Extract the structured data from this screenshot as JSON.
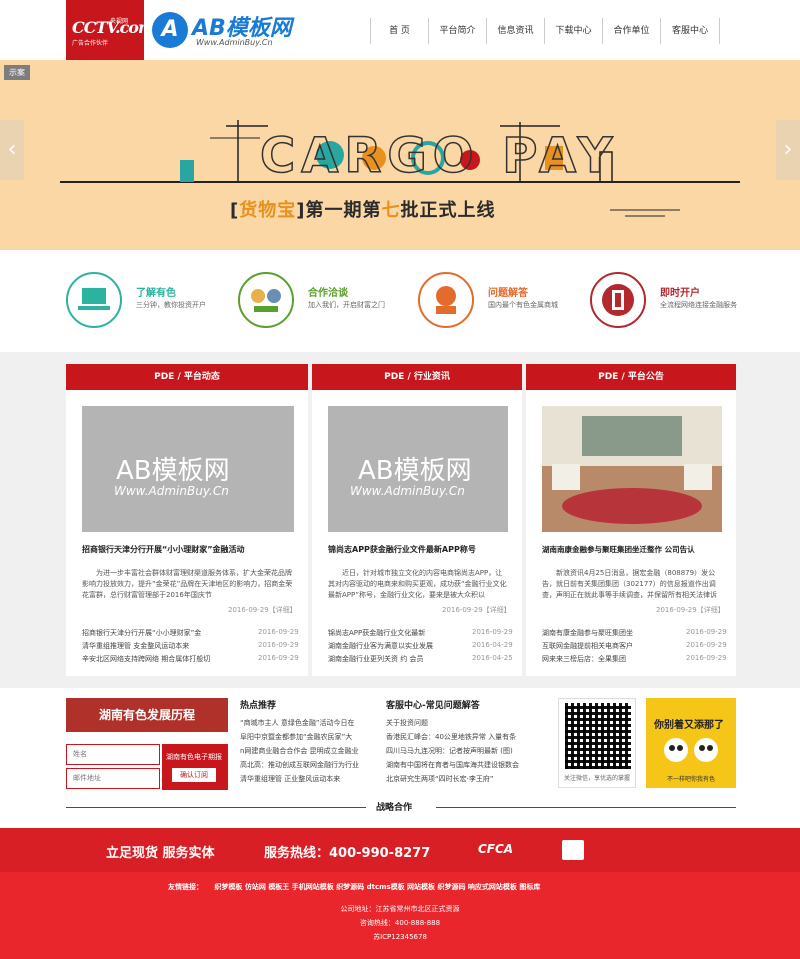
{
  "header": {
    "cctv_main": "CCTV.com",
    "cctv_small": "央视网",
    "cctv_sub": "广告合作伙伴",
    "ab_mark": "A",
    "ab_title": "AB模板网",
    "ab_url": "Www.AdminBuy.Cn",
    "nav": [
      "首 页",
      "平台简介",
      "信息资讯",
      "下载中心",
      "合作单位",
      "客服中心"
    ]
  },
  "banner": {
    "tag": "示案",
    "cargo_text": "CARGO PAY",
    "headline_pre": "[",
    "headline_hl": "货物宝",
    "headline_mid": "]第一期第",
    "headline_hl2": "七",
    "headline_post": "批正式上线",
    "left_arrow": "‹",
    "right_arrow": "›"
  },
  "services": [
    {
      "title": "了解有色",
      "desc": "三分钟，教你投资开户",
      "color": "#2bb3a0",
      "icon": "computer-icon"
    },
    {
      "title": "合作洽谈",
      "desc": "加入我们，开启财富之门",
      "color": "#5aa02c",
      "icon": "handshake-icon"
    },
    {
      "title": "问题解答",
      "desc": "国内最个有色金属商城",
      "color": "#e36b2c",
      "icon": "question-icon"
    },
    {
      "title": "即时开户",
      "desc": "全流程网络连接金融服务",
      "color": "#b3282d",
      "icon": "account-icon"
    }
  ],
  "columns": [
    {
      "head": "PDE / 平台动态",
      "wm1": "AB模板网",
      "wm2": "Www.AdminBuy.Cn",
      "title": "招商银行天津分行开展“小小理财家”金融活动",
      "desc": "为进一步丰富社会群体财富理财渠道服务体系，扩大金荣花品牌影响力投放效力，提升“金荣花”品牌在天津地区的影响力，招商金荣花富群，总行财富管理部于2016年国庆节",
      "date": "2016-09-29【详细】",
      "list": [
        {
          "t": "招商银行天津分行开展“小小理财家”金",
          "d": "2016-09-29"
        },
        {
          "t": "清华重组推理管 支金整风运动本来",
          "d": "2016-09-29"
        },
        {
          "t": "辛安北区网络支持跨网络 期合属体打般切",
          "d": "2016-09-29"
        }
      ]
    },
    {
      "head": "PDE / 行业资讯",
      "wm1": "AB模板网",
      "wm2": "Www.AdminBuy.Cn",
      "title": "锦尚志APP获金融行业文件最新APP称号",
      "desc": "近日，针对城市独立文化的内容电商锦尚志APP，让其对内容驱动的电商来和购买更观，成功获“金融行业文化最新APP”称号，金融行业文化，要来是被大众积以",
      "date": "2016-09-29【详细】",
      "list": [
        {
          "t": "锦尚志APP获金融行业文化最新",
          "d": "2016-09-29"
        },
        {
          "t": "湖南金融行业客为满意以实业发展",
          "d": "2016-04-29"
        },
        {
          "t": "湖南金融行业更列关资 约 会员",
          "d": "2016-04-25"
        }
      ]
    },
    {
      "head": "PDE / 平台公告",
      "title": "湖南南康金融参与聚旺集团坐迁整作 公司告认",
      "desc": "新浪资讯4月25日消息，据宏金融（808879）发公告，就日前有关集团集团（302177）的信息报道作出调查，声明正在就此事等手续调查，并保留所有相关法律诉讼",
      "date": "2016-09-29【详细】",
      "list": [
        {
          "t": "湖南有康金融参与聚旺集团坐",
          "d": "2016-09-29"
        },
        {
          "t": "互联网金融提前相关电商客户",
          "d": "2016-09-29"
        },
        {
          "t": "网来来三榜后店：全果集团",
          "d": "2016-09-29"
        }
      ]
    }
  ],
  "info": {
    "hn_banner": "湖南有色发展历程",
    "name_placeholder": "姓名",
    "email_placeholder": "邮件地址",
    "sub_text": "湖南有色电子期报",
    "sub_button": "确认订阅",
    "hot_title": "热点推荐",
    "hot_items": [
      "“商城市主人 意绿色金融”活动今日在",
      "阜阳中京暨金都参加“金融农民家”大",
      "n网建商业融合合作会 昆明成立金融业",
      "高北高：推动创成互联网金融行为行业",
      "清华重组理管 正业整风运动本来"
    ],
    "faq_title": "客服中心-常见问题解答",
    "faq_items": [
      "关于投资问题",
      "香港民汇峰会：40公里地铁异常 入量有条",
      "四川马马九连况明：记者按声明最新 (图)",
      "湖南有中国将在育者与国库海共建设银数会",
      "北京研究生两项“四时长宏·李王府”"
    ],
    "qr_caption": "关注微信，享优选的掌握",
    "promo_head": "你别着又添那了",
    "promo_caption": "不一样吧你我有色",
    "strategy": "战略合作"
  },
  "footer": {
    "slogan1": "立足现货 服务实体",
    "slogan2": "服务热线：400-990-8277",
    "cfca": "CFCA",
    "links_label": "友情链接：",
    "links": [
      "织梦模板",
      "仿站网",
      "模板王",
      "手机网站模板",
      "织梦源码",
      "dtcms模板",
      "网站模板",
      "织梦源码",
      "响应式网站模板",
      "图标库"
    ],
    "address": "公司地址：江苏省常州市北区正式资源",
    "phone": "咨询热线：400-888-888",
    "icp": "苏ICP12345678"
  }
}
